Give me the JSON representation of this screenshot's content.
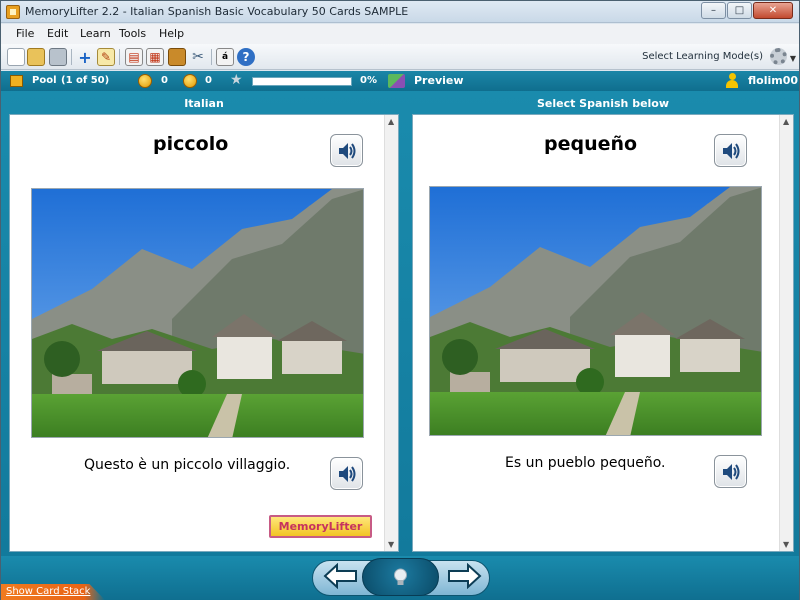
{
  "window": {
    "title": "MemoryLifter 2.2 - Italian Spanish Basic Vocabulary 50 Cards SAMPLE",
    "controls": {
      "minimize": "–",
      "maximize": "□",
      "close": "✕"
    }
  },
  "menu": {
    "items": [
      "File",
      "Edit",
      "Learn",
      "Tools",
      "Help"
    ]
  },
  "toolbar": {
    "icons": [
      "new-file-icon",
      "open-folder-icon",
      "print-icon",
      "add-card-icon",
      "edit-card-icon",
      "slideshow-icon",
      "card-settings-icon",
      "statistics-icon",
      "tools-icon",
      "font-icon",
      "help-icon"
    ],
    "learning_mode_label": "Select Learning Mode(s)"
  },
  "status": {
    "pool_label": "Pool",
    "pool_count": "(1 of 50)",
    "correct_count": "0",
    "wrong_count": "0",
    "progress_percent": 0,
    "progress_label": "0%",
    "preview_label": "Preview",
    "username": "flolim00"
  },
  "panes": {
    "left_header": "Italian",
    "right_header": "Select Spanish below"
  },
  "question": {
    "word": "piccolo",
    "sentence": "Questo è un piccolo villaggio."
  },
  "answer": {
    "word": "pequeño",
    "sentence": "Es un pueblo pequeño."
  },
  "logo": {
    "text": "MemoryLifter"
  },
  "nav": {
    "show_card_stack": "Show Card Stack"
  },
  "colors": {
    "accent": "#1a8bad",
    "status_bar": "#127a9c",
    "progress_fill": "#3fb34f",
    "logo_pink": "#c6325f"
  }
}
